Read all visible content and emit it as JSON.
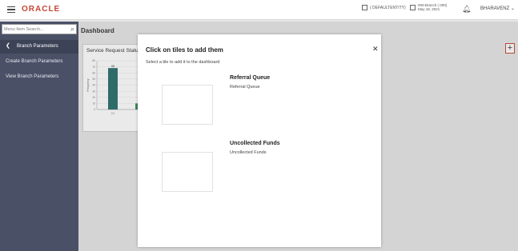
{
  "header": {
    "logo": "ORACLE",
    "entity": "( DEFAULTENTITY)",
    "branch_line1": "000-Branch ( 000)",
    "branch_line2": "May 18, 2021",
    "user": "BHARAVENZ"
  },
  "sidebar": {
    "search_placeholder": "Menu Item Search...",
    "back_label": "Branch Parameters",
    "items": [
      {
        "label": "Create Branch Parameters"
      },
      {
        "label": "View Branch Parameters"
      }
    ]
  },
  "main": {
    "title": "Dashboard",
    "tile_title": "Service Request Status"
  },
  "chart_data": {
    "type": "bar",
    "categories": [
      "0.0",
      ""
    ],
    "values": [
      68,
      10
    ],
    "ylabel": "Frequency",
    "yticks": [
      "80",
      "70",
      "60",
      "50",
      "40",
      "30",
      "20",
      "10",
      "0"
    ],
    "data_label": "68",
    "ylim": [
      0,
      80
    ],
    "colors": [
      "#2b6f6b",
      "#3d8c5a"
    ]
  },
  "modal": {
    "title": "Click on tiles to add them",
    "subtitle": "Select a tile to add it to the dashboard",
    "options": [
      {
        "title": "Referral Queue",
        "desc": "Referral Queue"
      },
      {
        "title": "Uncollected Funds",
        "desc": "Uncollected Funds"
      }
    ]
  }
}
